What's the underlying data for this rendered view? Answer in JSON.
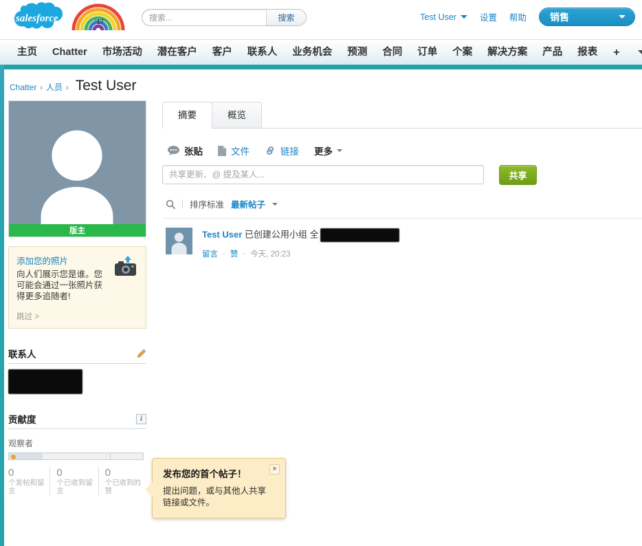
{
  "header": {
    "logo_text": "salesforce",
    "rainbow_year": "'17",
    "search": {
      "placeholder": "搜索...",
      "value": "",
      "button_label": "搜索"
    },
    "user_menu_label": "Test User",
    "setup_label": "设置",
    "help_label": "帮助",
    "app_selector_label": "销售"
  },
  "nav": {
    "items": [
      {
        "label": "主页"
      },
      {
        "label": "Chatter"
      },
      {
        "label": "市场活动"
      },
      {
        "label": "潜在客户"
      },
      {
        "label": "客户"
      },
      {
        "label": "联系人"
      },
      {
        "label": "业务机会"
      },
      {
        "label": "预测"
      },
      {
        "label": "合同"
      },
      {
        "label": "订单"
      },
      {
        "label": "个案"
      },
      {
        "label": "解决方案"
      },
      {
        "label": "产品"
      },
      {
        "label": "报表"
      }
    ],
    "add_tab_label": "+",
    "overflow_icon": "chevron-down-icon"
  },
  "breadcrumb": {
    "root": "Chatter",
    "sep": "›",
    "parent": "人员",
    "current": "Test User"
  },
  "sidebar": {
    "photo": {
      "moderator_badge": "版主",
      "placeholder_icon": "user-silhouette-icon"
    },
    "photo_prompt": {
      "title": "添加您的照片",
      "body": "向人们展示您是谁。您可能会通过一张照片获得更多追随者!",
      "skip_label": "跳过 >",
      "icon": "camera-upload-icon"
    },
    "contacts": {
      "title": "联系人",
      "edit_icon": "pencil-icon",
      "value_redacted": ""
    },
    "contribution": {
      "title": "贡献度",
      "info_icon": "info-icon",
      "level_label": "观察者",
      "progress_percent": 25,
      "stats": [
        {
          "value": "0",
          "label": "个发帖和留言"
        },
        {
          "value": "0",
          "label": "个已收到留言"
        },
        {
          "value": "0",
          "label": "个已收到的赞"
        }
      ]
    }
  },
  "main": {
    "tabs": [
      {
        "label": "摘要",
        "active": true
      },
      {
        "label": "概览",
        "active": false
      }
    ],
    "publisher": {
      "actions": [
        {
          "label": "张贴",
          "icon": "chat-bubble-icon",
          "active": true
        },
        {
          "label": "文件",
          "icon": "file-icon",
          "active": false
        },
        {
          "label": "链接",
          "icon": "link-icon",
          "active": false
        }
      ],
      "more_label": "更多",
      "input_placeholder": "共享更新、@ 提及某人...",
      "input_value": "",
      "share_button": "共享"
    },
    "feed_controls": {
      "search_icon": "search-icon",
      "sort_label": "排序标准",
      "sort_value": "最新帖子"
    },
    "feed": [
      {
        "author": "Test User",
        "action_text": "已创建公用小组",
        "target_text": "全",
        "target_redacted": true,
        "avatar_icon": "user-avatar-icon",
        "comment_label": "留言",
        "like_label": "赞",
        "dot": "·",
        "timestamp": "今天, 20:23",
        "menu_icon": "chevron-down-icon"
      }
    ]
  },
  "tooltip": {
    "title": "发布您的首个帖子！",
    "body": "提出问题，或与其他人共享链接或文件。",
    "close_label": "×"
  },
  "colors": {
    "brand_blue": "#1a84c7",
    "teal_band": "#23a3a7",
    "share_green": "#7aa81d",
    "badge_green": "#2ab84a",
    "tooltip_bg": "#fdedc6",
    "avatar_blue": "#6f93ad"
  }
}
